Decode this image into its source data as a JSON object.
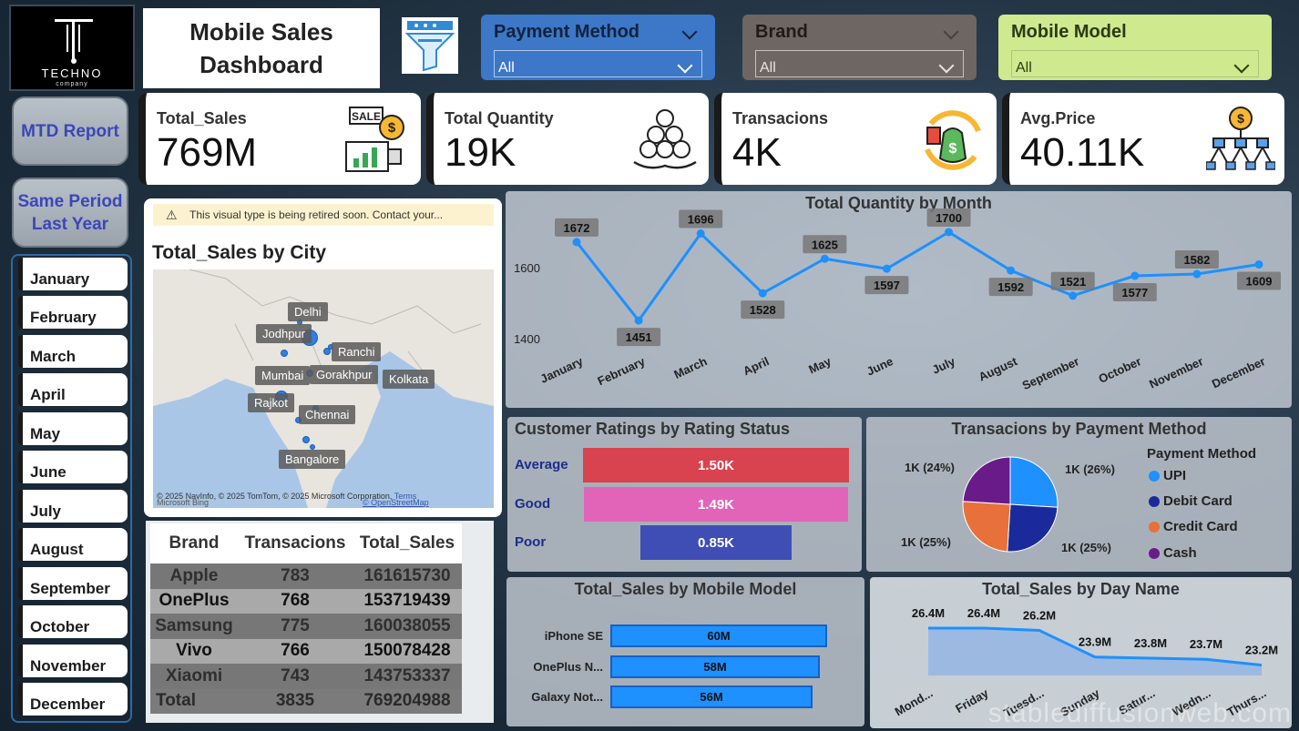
{
  "header": {
    "logo_text": "TECHNO",
    "logo_sub": "company",
    "title_line1": "Mobile Sales",
    "title_line2": "Dashboard"
  },
  "slicers": {
    "payment": {
      "label": "Payment Method",
      "value": "All",
      "color": "#3c77c8"
    },
    "brand": {
      "label": "Brand",
      "value": "All",
      "color": "#6e6662"
    },
    "model": {
      "label": "Mobile Model",
      "value": "All",
      "color": "#cfe98e"
    }
  },
  "nav": {
    "mtd": "MTD Report",
    "same_period_1": "Same Period",
    "same_period_2": "Last Year",
    "months": [
      "January",
      "February",
      "March",
      "April",
      "May",
      "June",
      "July",
      "August",
      "September",
      "October",
      "November",
      "December"
    ]
  },
  "kpis": [
    {
      "label": "Total_Sales",
      "value": "769M",
      "icon": "sale-tag-icon"
    },
    {
      "label": "Total Quantity",
      "value": "19K",
      "icon": "coins-hand-icon"
    },
    {
      "label": "Transacions",
      "value": "4K",
      "icon": "money-cycle-icon"
    },
    {
      "label": "Avg.Price",
      "value": "40.11K",
      "icon": "coin-network-icon"
    }
  ],
  "map": {
    "warning": "This visual type is being retired soon. Contact your...",
    "title": "Total_Sales by City",
    "cities": [
      "Delhi",
      "Jodhpur",
      "Ranchi",
      "Mumbai",
      "Gorakhpur",
      "Kolkata",
      "Rajkot",
      "Chennai",
      "Bangalore"
    ],
    "attribution": "© 2025 NavInfo, © 2025 TomTom, © 2025 Microsoft Corporation,",
    "terms": "Terms",
    "osm": "© OpenStreetMap",
    "bing": "Microsoft Bing"
  },
  "brand_table": {
    "headers": [
      "Brand",
      "Transacions",
      "Total_Sales"
    ],
    "rows": [
      [
        "Apple",
        "783",
        "161615730"
      ],
      [
        "OnePlus",
        "768",
        "153719439"
      ],
      [
        "Samsung",
        "775",
        "160038055"
      ],
      [
        "Vivo",
        "766",
        "150078428"
      ],
      [
        "Xiaomi",
        "743",
        "143753337"
      ]
    ],
    "total": [
      "Total",
      "3835",
      "769204988"
    ]
  },
  "charts": {
    "month_title": "Total Quantity by Month",
    "rating_title": "Customer Ratings by Rating Status",
    "pay_title": "Transacions by Payment Method",
    "pay_legend_title": "Payment Method",
    "model_title": "Total_Sales by Mobile Model",
    "day_title": "Total_Sales by Day Name"
  },
  "chart_data": [
    {
      "type": "line",
      "title": "Total Quantity by Month",
      "categories": [
        "January",
        "February",
        "March",
        "April",
        "May",
        "June",
        "July",
        "August",
        "September",
        "October",
        "November",
        "December"
      ],
      "values": [
        1672,
        1451,
        1696,
        1528,
        1625,
        1597,
        1700,
        1592,
        1521,
        1577,
        1582,
        1609
      ],
      "y_ticks": [
        "1400",
        "1600"
      ],
      "ylim": [
        1400,
        1700
      ],
      "color": "#1e90ff"
    },
    {
      "type": "bar",
      "title": "Customer Ratings by Rating Status",
      "categories": [
        "Average",
        "Good",
        "Poor"
      ],
      "values": [
        1.5,
        1.49,
        0.85
      ],
      "labels": [
        "1.50K",
        "1.49K",
        "0.85K"
      ],
      "colors": [
        "#d9434f",
        "#e264b8",
        "#3f4eb5"
      ]
    },
    {
      "type": "pie",
      "title": "Transacions by Payment Method",
      "categories": [
        "UPI",
        "Debit Card",
        "Credit Card",
        "Cash"
      ],
      "values": [
        26,
        25,
        25,
        24
      ],
      "labels": [
        "1K (26%)",
        "1K (25%)",
        "1K (25%)",
        "1K (24%)"
      ],
      "colors": [
        "#1e90ff",
        "#1a2a9a",
        "#e8703a",
        "#6a1b8a"
      ]
    },
    {
      "type": "bar",
      "title": "Total_Sales by Mobile Model",
      "categories": [
        "iPhone SE",
        "OnePlus N...",
        "Galaxy Not..."
      ],
      "values": [
        60,
        58,
        56
      ],
      "labels": [
        "60M",
        "58M",
        "56M"
      ],
      "color": "#1e90ff"
    },
    {
      "type": "area",
      "title": "Total_Sales by Day Name",
      "categories": [
        "Mond...",
        "Friday",
        "Tuesd...",
        "Sunday",
        "Satur...",
        "Wedn...",
        "Thurs..."
      ],
      "values": [
        26.4,
        26.4,
        26.2,
        23.9,
        23.8,
        23.7,
        23.2
      ],
      "labels": [
        "26.4M",
        "26.4M",
        "26.2M",
        "23.9M",
        "23.8M",
        "23.7M",
        "23.2M"
      ],
      "color": "#1e90ff"
    }
  ],
  "watermark": "stablediffusionweb.com"
}
